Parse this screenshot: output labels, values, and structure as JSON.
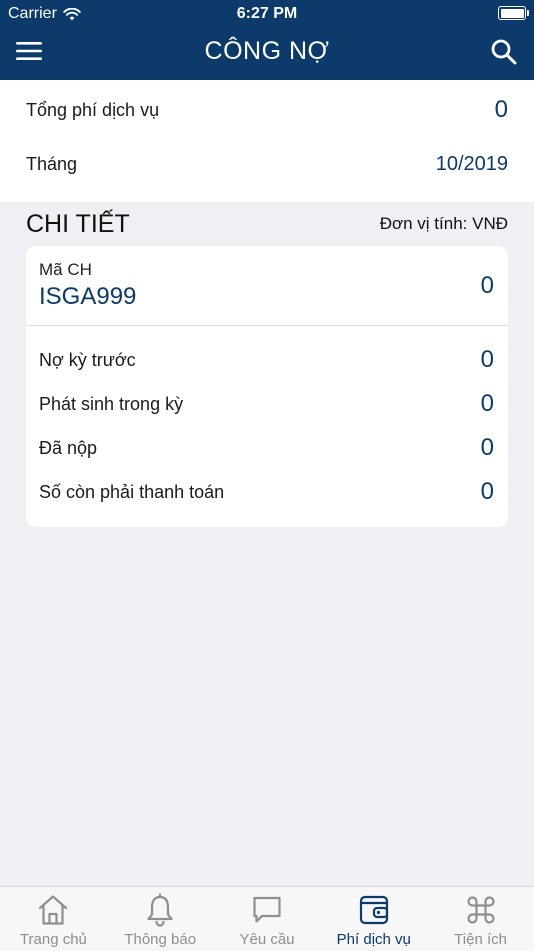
{
  "status_bar": {
    "carrier": "Carrier",
    "time": "6:27 PM"
  },
  "header": {
    "title": "CÔNG NỢ",
    "menu_icon": "hamburger-menu-icon",
    "search_icon": "search-icon"
  },
  "summary": {
    "total_label": "Tổng phí dịch vụ",
    "total_value": "0",
    "month_label": "Tháng",
    "month_value": "10/2019"
  },
  "detail": {
    "heading": "CHI TIẾT",
    "unit": "Đơn vị tính: VNĐ",
    "unit_code_label": "Mã CH",
    "unit_code_value": "ISGA999",
    "unit_code_amount": "0",
    "rows": [
      {
        "label": "Nợ kỳ trước",
        "value": "0"
      },
      {
        "label": "Phát sinh trong kỳ",
        "value": "0"
      },
      {
        "label": "Đã nộp",
        "value": "0"
      },
      {
        "label": "Số còn phải thanh toán",
        "value": "0"
      }
    ]
  },
  "tabs": [
    {
      "label": "Trang chủ",
      "icon": "home-icon"
    },
    {
      "label": "Thông báo",
      "icon": "bell-icon"
    },
    {
      "label": "Yêu cầu",
      "icon": "chat-bubble-icon"
    },
    {
      "label": "Phí dịch vụ",
      "icon": "wallet-icon",
      "active": true
    },
    {
      "label": "Tiện ích",
      "icon": "command-icon"
    }
  ],
  "colors": {
    "primary": "#0b3a6b",
    "background": "#efeff4",
    "tab_inactive": "#8e8e93"
  }
}
